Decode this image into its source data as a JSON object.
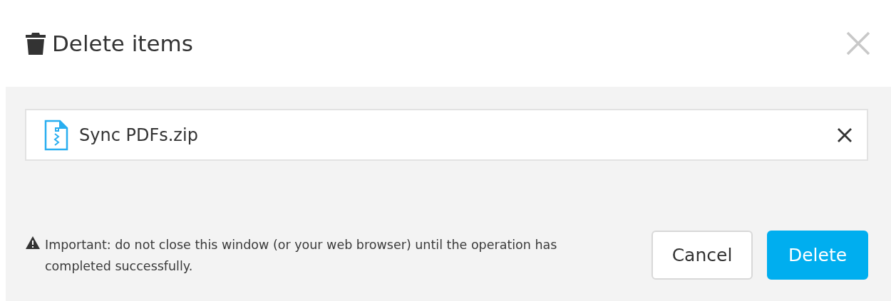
{
  "dialog": {
    "title": "Delete items"
  },
  "items": [
    {
      "name": "Sync PDFs.zip"
    }
  ],
  "warning": "Important: do not close this window (or your web browser) until the operation has completed successfully.",
  "buttons": [
    {
      "label": "Cancel",
      "kind": "secondary"
    },
    {
      "label": "Delete",
      "kind": "primary"
    }
  ]
}
